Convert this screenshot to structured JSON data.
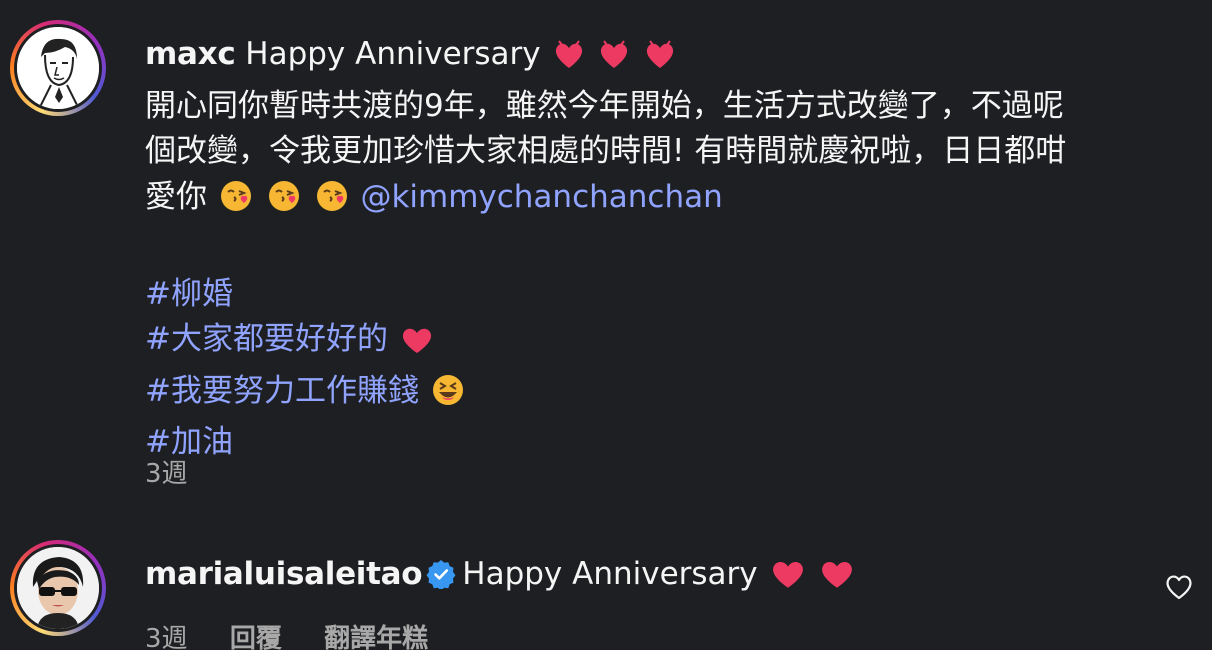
{
  "caption": {
    "username": "maxc",
    "greeting": "Happy Anniversary",
    "line1": "開心同你暫時共渡的9年，雖然今年開始，生活方式改變了，不過呢",
    "line2": "個改變，令我更加珍惜大家相處的時間! 有時間就慶祝啦，日日都咁",
    "line3": "愛你",
    "mention": "@kimmychanchanchan",
    "hashtags": [
      "#柳婚",
      "#大家都要好好的",
      "#我要努力工作賺錢",
      "#加油"
    ],
    "time": "3週"
  },
  "comment": {
    "username": "marialuisaleitao",
    "text": "Happy Anniversary",
    "time": "3週",
    "reply_label": "回覆",
    "translate_label": "翻譯年糕"
  },
  "colors": {
    "background": "#1e1f22",
    "text": "#f5f5f5",
    "link": "#8fa3ff",
    "muted": "#a8a8a8",
    "heart": "#ed3a63",
    "verified": "#3897f0"
  },
  "icons": {
    "verified": "verified-badge-icon",
    "like": "heart-outline-icon",
    "emoji_heart": "heart-suit",
    "emoji_kiss": "face-blowing-kiss",
    "emoji_laugh": "grinning-squinting-face"
  }
}
